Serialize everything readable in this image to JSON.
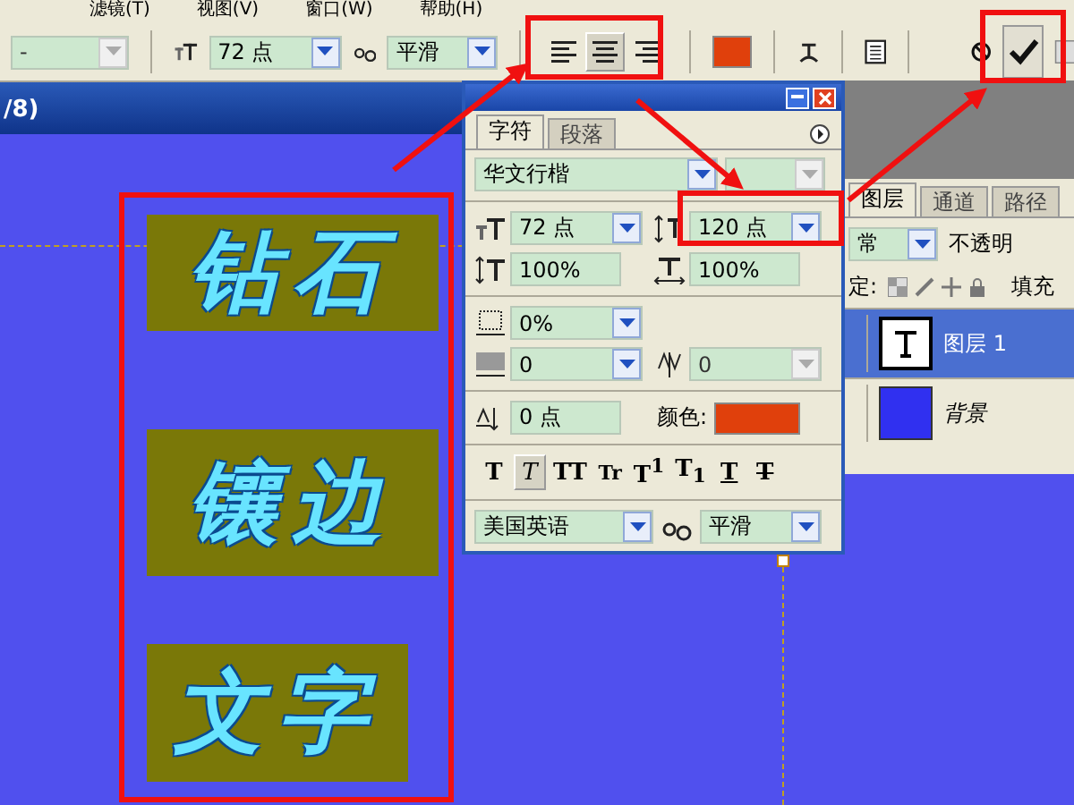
{
  "menu_bar": [
    {
      "label": "滤镜(T)"
    },
    {
      "label": "视图(V)"
    },
    {
      "label": "窗口(W)"
    },
    {
      "label": "帮助(H)"
    }
  ],
  "options_bar": {
    "font_style": "-",
    "font_style_disabled": true,
    "font_size": "72 点",
    "antialias": "平滑",
    "alignment": [
      {
        "kind": "left",
        "selected": false
      },
      {
        "kind": "center",
        "selected": true
      },
      {
        "kind": "right",
        "selected": false
      }
    ],
    "color": "#e0400c"
  },
  "document": {
    "title": "/8)",
    "text_blocks": [
      {
        "text": "钻石"
      },
      {
        "text": "镶边"
      },
      {
        "text": "文字"
      }
    ]
  },
  "character_panel": {
    "tabs": [
      {
        "label": "字符",
        "selected": true
      },
      {
        "label": "段落",
        "selected": false
      }
    ],
    "font_family": "华文行楷",
    "font_size": "72 点",
    "leading": "120 点",
    "vertical_scale": "100%",
    "horizontal_scale": "100%",
    "tsume": "0%",
    "kerning": "0",
    "tracking": "0",
    "tracking_disabled": true,
    "baseline_shift": "0 点",
    "color_label": "颜色:",
    "color": "#e0400c",
    "style_buttons": [
      {
        "kind": "bold",
        "label": "T",
        "selected": false
      },
      {
        "kind": "italic",
        "label": "T",
        "selected": true
      },
      {
        "kind": "caps",
        "label": "TT",
        "selected": false
      },
      {
        "kind": "smallcaps",
        "label": "Tr",
        "selected": false
      },
      {
        "kind": "super",
        "label": "T$^{1}$",
        "selected": false
      },
      {
        "kind": "sub",
        "label": "T$_{1}$",
        "selected": false
      },
      {
        "kind": "underline",
        "label": "T",
        "selected": false
      },
      {
        "kind": "strike",
        "label": "T",
        "selected": false
      }
    ],
    "language": "美国英语",
    "antialias": "平滑"
  },
  "layers_panel": {
    "tabs": [
      {
        "label": "图层",
        "selected": true
      },
      {
        "label": "通道",
        "selected": false
      },
      {
        "label": "路径",
        "selected": false
      }
    ],
    "blend_mode": "常",
    "opacity_label": "不透明",
    "lock_label": "定:",
    "fill_label": "填充",
    "layers": [
      {
        "name": "图层 1",
        "kind": "text",
        "selected": true
      },
      {
        "name": "背景",
        "kind": "image",
        "selected": false
      }
    ]
  }
}
